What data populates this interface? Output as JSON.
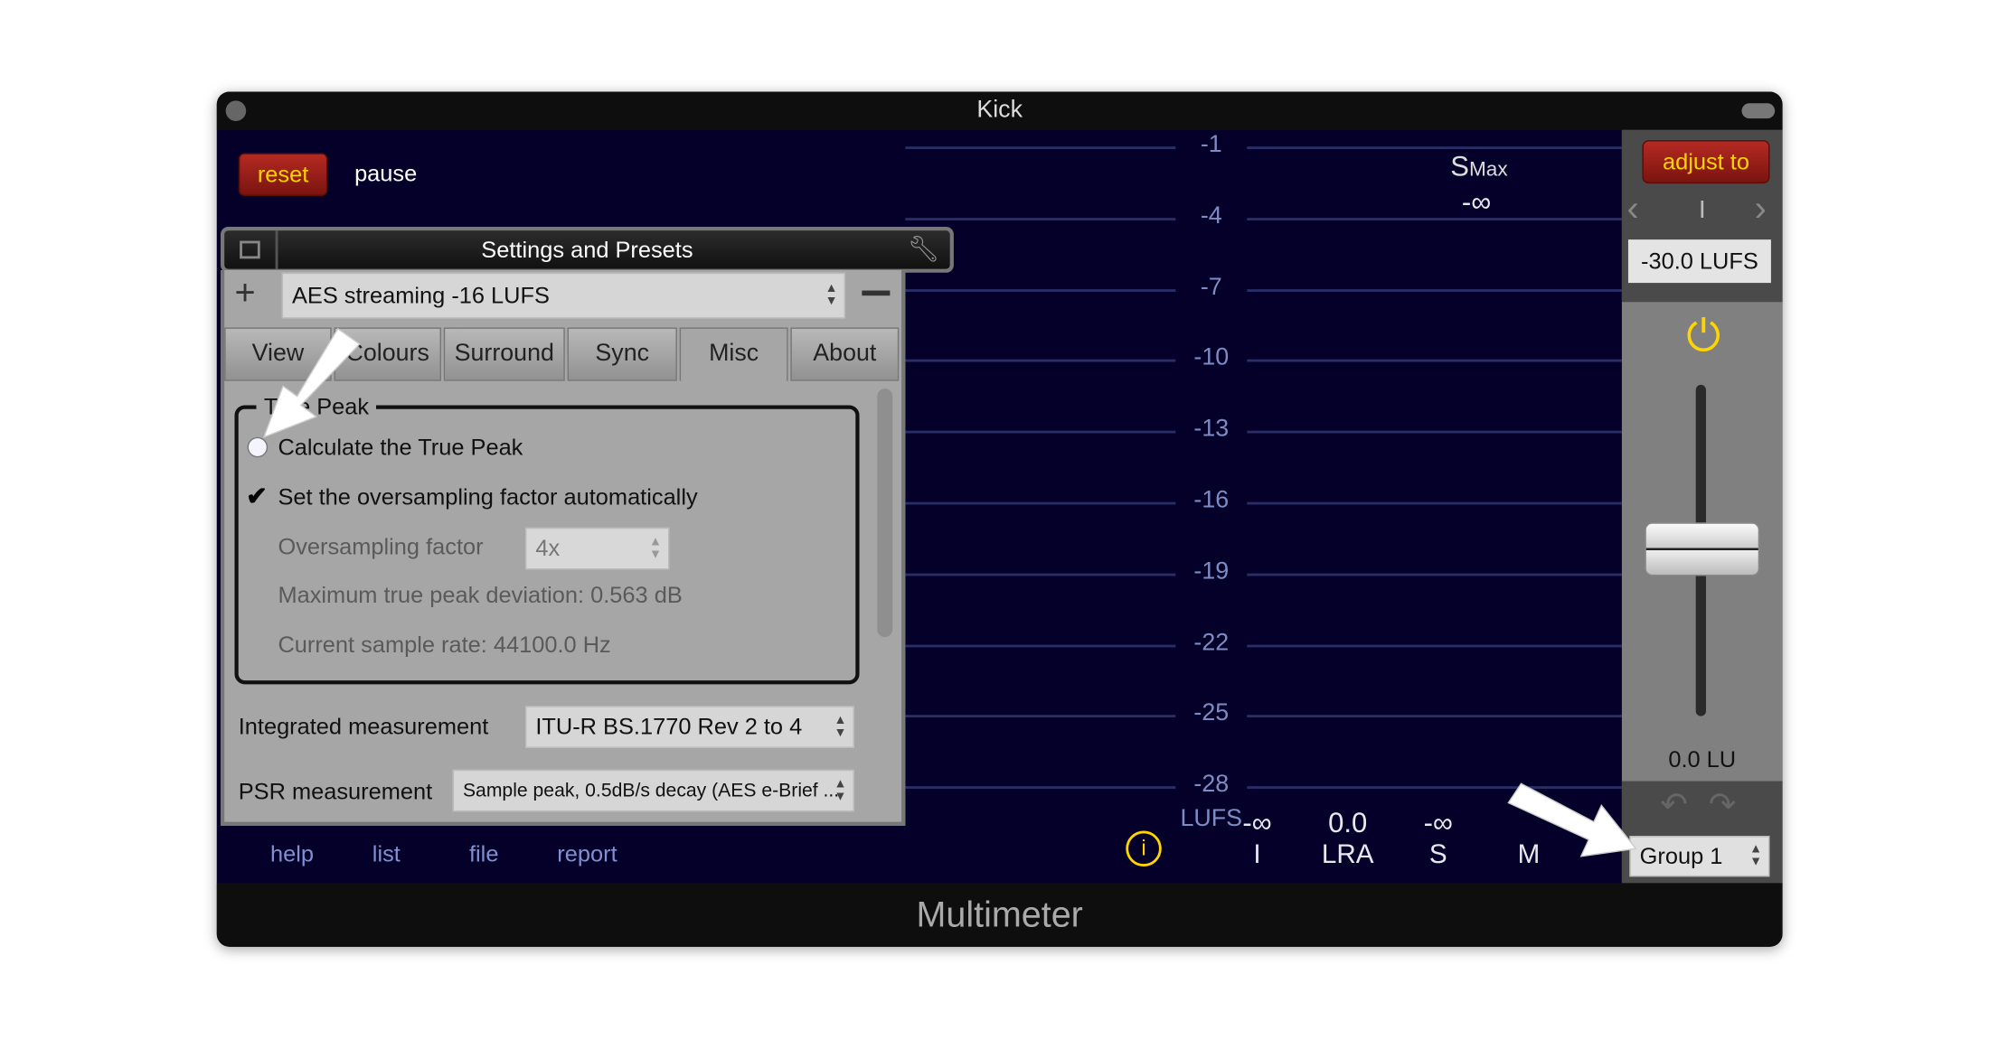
{
  "window": {
    "title": "Kick",
    "footer": "Multimeter"
  },
  "toolbar": {
    "reset": "reset",
    "pause": "pause"
  },
  "settings": {
    "title": "Settings and Presets",
    "preset": "AES streaming -16 LUFS",
    "tabs": [
      "View",
      "Colours",
      "Surround",
      "Sync",
      "Misc",
      "About"
    ],
    "active_tab": "Misc",
    "group_title": "True Peak",
    "calc_true_peak": {
      "label": "Calculate the True Peak",
      "checked": false
    },
    "auto_oversampling": {
      "label": "Set the oversampling factor automatically",
      "checked": true
    },
    "oversampling_label": "Oversampling factor",
    "oversampling_value": "4x",
    "max_deviation": "Maximum true peak deviation: 0.563 dB",
    "sample_rate": "Current sample rate: 44100.0 Hz",
    "integrated_label": "Integrated measurement",
    "integrated_value": "ITU-R BS.1770 Rev 2 to 4",
    "psr_label": "PSR measurement",
    "psr_value": "Sample peak, 0.5dB/s decay (AES e-Brief ..."
  },
  "scale": {
    "ticks": [
      "-1",
      "-4",
      "-7",
      "-10",
      "-13",
      "-16",
      "-19",
      "-22",
      "-25",
      "-28"
    ],
    "unit": "LUFS"
  },
  "smax": {
    "label": "S",
    "sub": "Max",
    "value": "-∞"
  },
  "readouts": [
    {
      "value": "-∞",
      "label": "I"
    },
    {
      "value": "0.0",
      "label": "LRA"
    },
    {
      "value": "-∞",
      "label": "S"
    },
    {
      "value": "",
      "label": "M"
    }
  ],
  "footer_links": [
    "help",
    "list",
    "file",
    "report"
  ],
  "right": {
    "adjust": "adjust to",
    "indicator": "I",
    "target": "-30.0 LUFS",
    "gain": "0.0 LU",
    "group": "Group 1"
  },
  "colors": {
    "accent": "#ffd400",
    "background": "#05002a",
    "button": "#9a1d16"
  },
  "icons": {
    "power": "power-icon",
    "info": "info-icon",
    "undo": "undo-icon",
    "redo": "redo-icon",
    "wrench": "wrench-icon"
  }
}
